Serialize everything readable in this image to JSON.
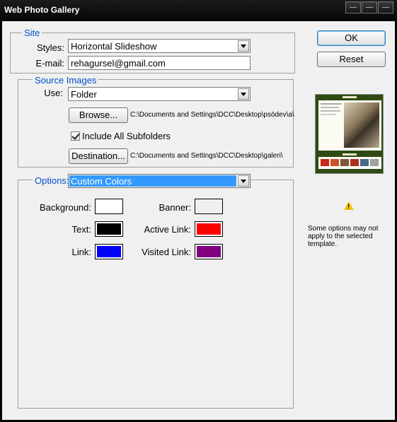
{
  "window": {
    "title": "Web Photo Gallery"
  },
  "site": {
    "legend": "Site",
    "styles_label": "Styles:",
    "styles_value": "Horizontal Slideshow",
    "email_label": "E-mail:",
    "email_value": "rehagursel@gmail.com"
  },
  "source": {
    "legend": "Source Images",
    "use_label": "Use:",
    "use_value": "Folder",
    "browse_label": "Browse...",
    "browse_path": "C:\\Documents and Settings\\DCC\\Desktop\\psödev\\a\\",
    "include_subfolders_label": "Include All Subfolders",
    "include_subfolders_checked": true,
    "destination_label": "Destination...",
    "destination_path": "C:\\Documents and Settings\\DCC\\Desktop\\galeri\\"
  },
  "options": {
    "legend": "Options:",
    "value": "Custom Colors",
    "colors": {
      "background": {
        "label": "Background:",
        "color": "#ffffff"
      },
      "banner": {
        "label": "Banner:",
        "color": "#f0f0f0"
      },
      "text": {
        "label": "Text:",
        "color": "#000000"
      },
      "active_link": {
        "label": "Active Link:",
        "color": "#ff0000"
      },
      "link": {
        "label": "Link:",
        "color": "#0000ff"
      },
      "visited_link": {
        "label": "Visited Link:",
        "color": "#800080"
      }
    }
  },
  "buttons": {
    "ok": "OK",
    "reset": "Reset"
  },
  "notice": {
    "icon": "warning-icon",
    "line1": "Some options may not",
    "line2": "apply to the selected",
    "line3": "template."
  },
  "theme": {
    "accent": "#0050c8",
    "selection": "#3399ff"
  }
}
